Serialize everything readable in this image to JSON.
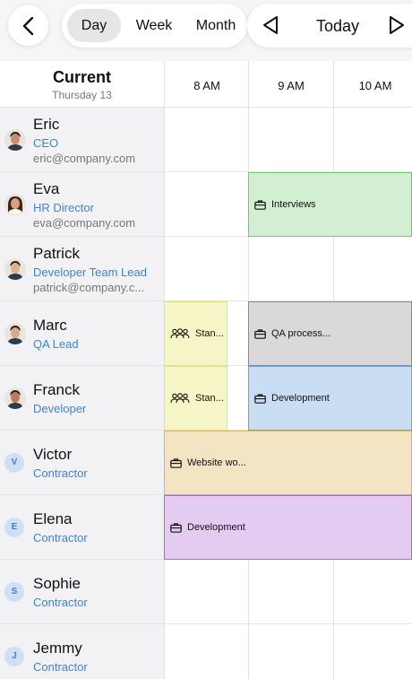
{
  "toolbar": {
    "views": [
      "Day",
      "Week",
      "Month"
    ],
    "selected_view": "Day",
    "today_label": "Today"
  },
  "header": {
    "current_title": "Current",
    "current_date": "Thursday 13",
    "hours": [
      "8 AM",
      "9 AM",
      "10 AM"
    ]
  },
  "people": [
    {
      "name": "Eric",
      "role": "CEO",
      "email": "eric@company.com",
      "avatar": "photo",
      "skin": "#c98f6c"
    },
    {
      "name": "Eva",
      "role": "HR Director",
      "email": "eva@company.com",
      "avatar": "photo",
      "skin": "#d9a27f"
    },
    {
      "name": "Patrick",
      "role": "Developer Team Lead",
      "email": "patrick@company.c...",
      "avatar": "photo",
      "skin": "#e0b08d"
    },
    {
      "name": "Marc",
      "role": "QA Lead",
      "email": "",
      "avatar": "photo",
      "skin": "#d8a98a"
    },
    {
      "name": "Franck",
      "role": "Developer",
      "email": "",
      "avatar": "photo",
      "skin": "#b97d5b"
    },
    {
      "name": "Victor",
      "role": "Contractor",
      "email": "",
      "avatar": "letter",
      "initial": "V"
    },
    {
      "name": "Elena",
      "role": "Contractor",
      "email": "",
      "avatar": "letter",
      "initial": "E"
    },
    {
      "name": "Sophie",
      "role": "Contractor",
      "email": "",
      "avatar": "letter",
      "initial": "S"
    },
    {
      "name": "Jemmy",
      "role": "Contractor",
      "email": "",
      "avatar": "letter",
      "initial": "J"
    }
  ],
  "events": [
    {
      "row": 1,
      "label": "Interviews",
      "icon": "briefcase-icon",
      "color": "#d3efd1",
      "border": "#77c777"
    },
    {
      "row": 3,
      "label": "Stan...",
      "icon": "group-icon",
      "color": "#f6f5c5",
      "border": "#e3e18a"
    },
    {
      "row": 3,
      "label": "QA process...",
      "icon": "briefcase-icon",
      "color": "#d9d9d9",
      "border": "#8a8a8a"
    },
    {
      "row": 4,
      "label": "Stan...",
      "icon": "group-icon",
      "color": "#f6f5c5",
      "border": "#e3e18a"
    },
    {
      "row": 4,
      "label": "Development",
      "icon": "briefcase-icon",
      "color": "#c9def3",
      "border": "#6ea3dc"
    },
    {
      "row": 5,
      "label": "Website wo...",
      "icon": "briefcase-icon",
      "color": "#f3e4c4",
      "border": "#d9b466"
    },
    {
      "row": 6,
      "label": "Development",
      "icon": "briefcase-icon",
      "color": "#e3cbf1",
      "border": "#a86bcc"
    }
  ]
}
